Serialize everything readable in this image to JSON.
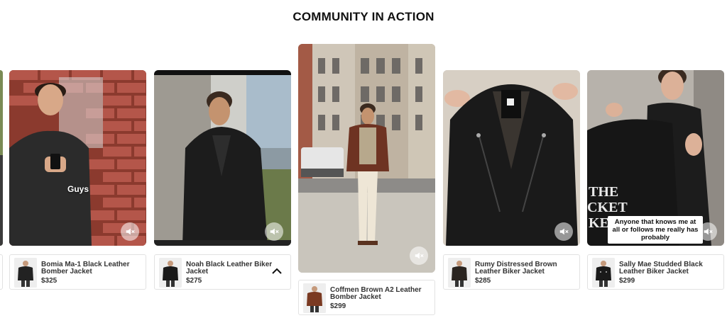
{
  "section_title": "COMMUNITY IN ACTION",
  "cards": [
    {
      "caption": "Guys",
      "product": {
        "name": "Bomia Ma-1 Black Leather Bomber Jacket",
        "price": "$325"
      }
    },
    {
      "caption": "",
      "product": {
        "name": "Noah Black Leather Biker Jacket",
        "price": "$275"
      }
    },
    {
      "caption": "",
      "product": {
        "name": "Coffmen Brown A2 Leather Bomber Jacket",
        "price": "$299"
      }
    },
    {
      "caption": "",
      "product": {
        "name": "Rumy Distressed Brown Leather Biker Jacket",
        "price": "$285"
      }
    },
    {
      "caption": "Anyone that knows me at all or follows me really has probably",
      "product": {
        "name": "Sally Mae Studded Black Leather Biker Jacket",
        "price": "$299"
      }
    }
  ],
  "icons": {
    "mute": "speaker-muted-icon",
    "collapse": "chevron-up-icon"
  },
  "colors": {
    "brick": "#a0493a",
    "brown_jacket": "#6e3322",
    "black_leather": "#1a1a1a"
  }
}
